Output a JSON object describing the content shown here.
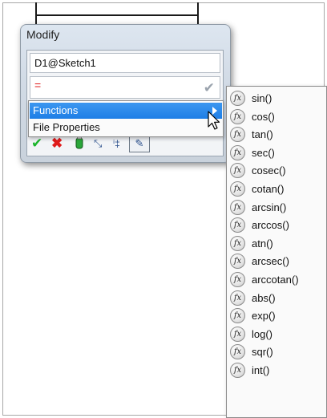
{
  "dialog": {
    "title": "Modify",
    "name_field_value": "D1@Sketch1",
    "equation_prefix": "="
  },
  "menu": {
    "items": [
      {
        "label": "Functions",
        "selected": true,
        "has_submenu": true
      },
      {
        "label": "File Properties",
        "selected": false,
        "has_submenu": false
      }
    ]
  },
  "functions_submenu": {
    "icon_label": "fx",
    "items": [
      {
        "label": "sin()"
      },
      {
        "label": "cos()"
      },
      {
        "label": "tan()"
      },
      {
        "label": "sec()"
      },
      {
        "label": "cosec()"
      },
      {
        "label": "cotan()"
      },
      {
        "label": "arcsin()"
      },
      {
        "label": "arccos()"
      },
      {
        "label": "atn()"
      },
      {
        "label": "arcsec()"
      },
      {
        "label": "arccotan()"
      },
      {
        "label": "abs()"
      },
      {
        "label": "exp()"
      },
      {
        "label": "log()"
      },
      {
        "label": "sqr()"
      },
      {
        "label": "int()"
      }
    ]
  },
  "colors": {
    "selection": "#1e7ee6",
    "equals_sign": "#e01b1b",
    "ok_green": "#1bb52c",
    "cancel_red": "#e01b1b"
  },
  "toolbar_icons": [
    "ok-check-icon",
    "cancel-x-icon",
    "rebuild-icon",
    "reverse-dimension-icon",
    "mark-dimension-icon",
    "help-icon"
  ]
}
